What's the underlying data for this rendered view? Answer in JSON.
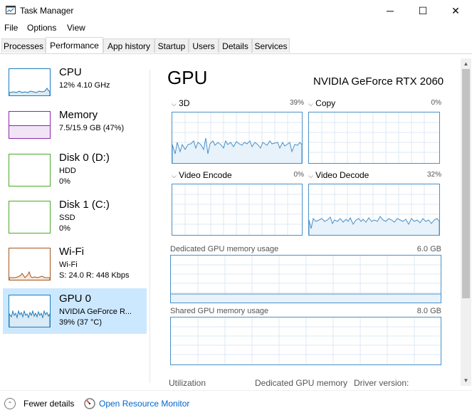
{
  "window": {
    "title": "Task Manager",
    "minimize": "─",
    "maximize": "☐",
    "close": "✕"
  },
  "menu": [
    "File",
    "Options",
    "View"
  ],
  "tabs": [
    "Processes",
    "Performance",
    "App history",
    "Startup",
    "Users",
    "Details",
    "Services"
  ],
  "active_tab": "Performance",
  "sidebar": {
    "items": [
      {
        "title": "CPU",
        "line1": "12%  4.10 GHz",
        "line2": "",
        "color": "#1a7dbc"
      },
      {
        "title": "Memory",
        "line1": "7.5/15.9 GB (47%)",
        "line2": "",
        "color": "#8b28a8"
      },
      {
        "title": "Disk 0 (D:)",
        "line1": "HDD",
        "line2": "0%",
        "color": "#4aa826"
      },
      {
        "title": "Disk 1 (C:)",
        "line1": "SSD",
        "line2": "0%",
        "color": "#4aa826"
      },
      {
        "title": "Wi-Fi",
        "line1": "Wi-Fi",
        "line2": "S: 24.0  R: 448 Kbps",
        "color": "#a7531a"
      },
      {
        "title": "GPU 0",
        "line1": "NVIDIA GeForce R...",
        "line2": "39%  (37 °C)",
        "color": "#1a7dbc"
      }
    ],
    "selected": 5
  },
  "main": {
    "title": "GPU",
    "model": "NVIDIA GeForce RTX 2060",
    "engines": [
      {
        "name": "3D",
        "percent": "39%"
      },
      {
        "name": "Copy",
        "percent": "0%"
      },
      {
        "name": "Video Encode",
        "percent": "0%"
      },
      {
        "name": "Video Decode",
        "percent": "32%"
      }
    ],
    "dedicated": {
      "label": "Dedicated GPU memory usage",
      "max": "6.0 GB"
    },
    "shared": {
      "label": "Shared GPU memory usage",
      "max": "8.0 GB"
    },
    "stats_labels": [
      "Utilization",
      "Dedicated GPU memory",
      "Driver version:"
    ]
  },
  "footer": {
    "fewer_details": "Fewer details",
    "resource_monitor": "Open Resource Monitor"
  },
  "colors": {
    "graph_line": "#4a90c8",
    "graph_fill": "#e8f2fa",
    "selected_bg": "#cce8ff",
    "link": "#0066cc"
  }
}
